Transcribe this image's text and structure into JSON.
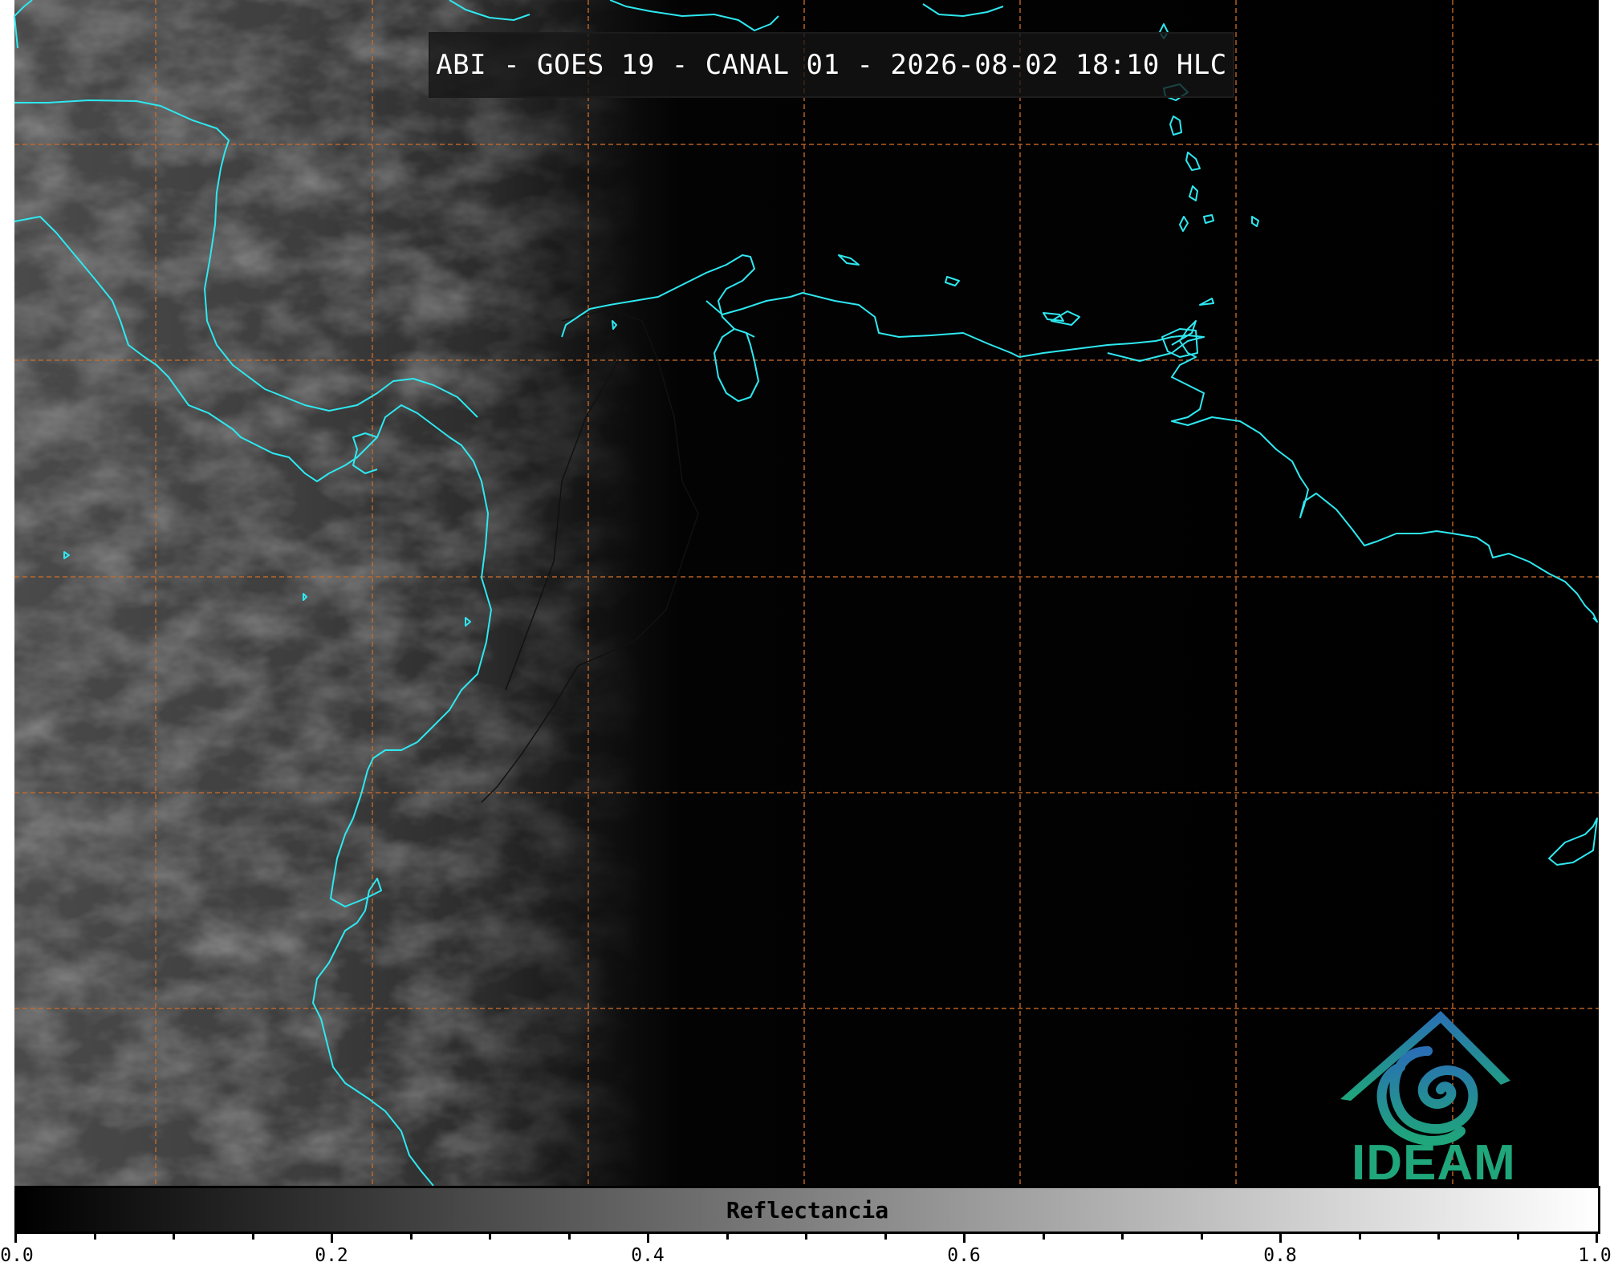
{
  "title": "ABI - GOES 19 - CANAL 01 - 2026-08-02 18:10 HLC",
  "colorbar": {
    "label": "Reflectancia",
    "ticks": [
      "0.0",
      "0.2",
      "0.4",
      "0.6",
      "0.8",
      "1.0"
    ],
    "range": [
      0.0,
      1.0
    ]
  },
  "logo": {
    "text": "IDEAM"
  },
  "colors": {
    "coastline": "#2ee8f0",
    "grid": "#c86a2a",
    "logo_blue": "#2a6fb5",
    "logo_green": "#1fa67a"
  }
}
